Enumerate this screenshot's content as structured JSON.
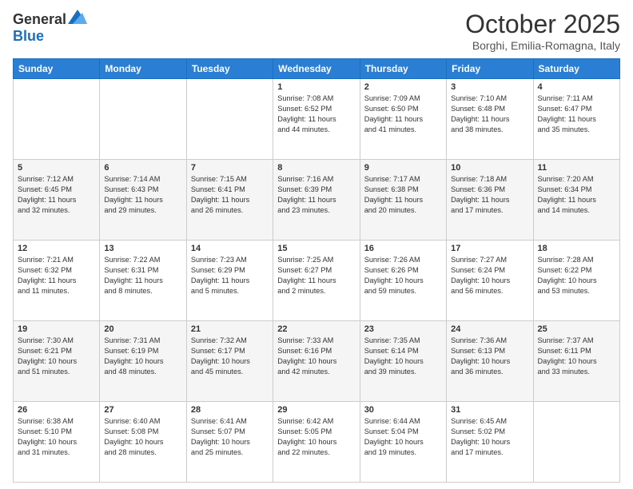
{
  "header": {
    "logo_general": "General",
    "logo_blue": "Blue",
    "month": "October 2025",
    "location": "Borghi, Emilia-Romagna, Italy"
  },
  "days_of_week": [
    "Sunday",
    "Monday",
    "Tuesday",
    "Wednesday",
    "Thursday",
    "Friday",
    "Saturday"
  ],
  "weeks": [
    [
      {
        "num": "",
        "content": ""
      },
      {
        "num": "",
        "content": ""
      },
      {
        "num": "",
        "content": ""
      },
      {
        "num": "1",
        "content": "Sunrise: 7:08 AM\nSunset: 6:52 PM\nDaylight: 11 hours\nand 44 minutes."
      },
      {
        "num": "2",
        "content": "Sunrise: 7:09 AM\nSunset: 6:50 PM\nDaylight: 11 hours\nand 41 minutes."
      },
      {
        "num": "3",
        "content": "Sunrise: 7:10 AM\nSunset: 6:48 PM\nDaylight: 11 hours\nand 38 minutes."
      },
      {
        "num": "4",
        "content": "Sunrise: 7:11 AM\nSunset: 6:47 PM\nDaylight: 11 hours\nand 35 minutes."
      }
    ],
    [
      {
        "num": "5",
        "content": "Sunrise: 7:12 AM\nSunset: 6:45 PM\nDaylight: 11 hours\nand 32 minutes."
      },
      {
        "num": "6",
        "content": "Sunrise: 7:14 AM\nSunset: 6:43 PM\nDaylight: 11 hours\nand 29 minutes."
      },
      {
        "num": "7",
        "content": "Sunrise: 7:15 AM\nSunset: 6:41 PM\nDaylight: 11 hours\nand 26 minutes."
      },
      {
        "num": "8",
        "content": "Sunrise: 7:16 AM\nSunset: 6:39 PM\nDaylight: 11 hours\nand 23 minutes."
      },
      {
        "num": "9",
        "content": "Sunrise: 7:17 AM\nSunset: 6:38 PM\nDaylight: 11 hours\nand 20 minutes."
      },
      {
        "num": "10",
        "content": "Sunrise: 7:18 AM\nSunset: 6:36 PM\nDaylight: 11 hours\nand 17 minutes."
      },
      {
        "num": "11",
        "content": "Sunrise: 7:20 AM\nSunset: 6:34 PM\nDaylight: 11 hours\nand 14 minutes."
      }
    ],
    [
      {
        "num": "12",
        "content": "Sunrise: 7:21 AM\nSunset: 6:32 PM\nDaylight: 11 hours\nand 11 minutes."
      },
      {
        "num": "13",
        "content": "Sunrise: 7:22 AM\nSunset: 6:31 PM\nDaylight: 11 hours\nand 8 minutes."
      },
      {
        "num": "14",
        "content": "Sunrise: 7:23 AM\nSunset: 6:29 PM\nDaylight: 11 hours\nand 5 minutes."
      },
      {
        "num": "15",
        "content": "Sunrise: 7:25 AM\nSunset: 6:27 PM\nDaylight: 11 hours\nand 2 minutes."
      },
      {
        "num": "16",
        "content": "Sunrise: 7:26 AM\nSunset: 6:26 PM\nDaylight: 10 hours\nand 59 minutes."
      },
      {
        "num": "17",
        "content": "Sunrise: 7:27 AM\nSunset: 6:24 PM\nDaylight: 10 hours\nand 56 minutes."
      },
      {
        "num": "18",
        "content": "Sunrise: 7:28 AM\nSunset: 6:22 PM\nDaylight: 10 hours\nand 53 minutes."
      }
    ],
    [
      {
        "num": "19",
        "content": "Sunrise: 7:30 AM\nSunset: 6:21 PM\nDaylight: 10 hours\nand 51 minutes."
      },
      {
        "num": "20",
        "content": "Sunrise: 7:31 AM\nSunset: 6:19 PM\nDaylight: 10 hours\nand 48 minutes."
      },
      {
        "num": "21",
        "content": "Sunrise: 7:32 AM\nSunset: 6:17 PM\nDaylight: 10 hours\nand 45 minutes."
      },
      {
        "num": "22",
        "content": "Sunrise: 7:33 AM\nSunset: 6:16 PM\nDaylight: 10 hours\nand 42 minutes."
      },
      {
        "num": "23",
        "content": "Sunrise: 7:35 AM\nSunset: 6:14 PM\nDaylight: 10 hours\nand 39 minutes."
      },
      {
        "num": "24",
        "content": "Sunrise: 7:36 AM\nSunset: 6:13 PM\nDaylight: 10 hours\nand 36 minutes."
      },
      {
        "num": "25",
        "content": "Sunrise: 7:37 AM\nSunset: 6:11 PM\nDaylight: 10 hours\nand 33 minutes."
      }
    ],
    [
      {
        "num": "26",
        "content": "Sunrise: 6:38 AM\nSunset: 5:10 PM\nDaylight: 10 hours\nand 31 minutes."
      },
      {
        "num": "27",
        "content": "Sunrise: 6:40 AM\nSunset: 5:08 PM\nDaylight: 10 hours\nand 28 minutes."
      },
      {
        "num": "28",
        "content": "Sunrise: 6:41 AM\nSunset: 5:07 PM\nDaylight: 10 hours\nand 25 minutes."
      },
      {
        "num": "29",
        "content": "Sunrise: 6:42 AM\nSunset: 5:05 PM\nDaylight: 10 hours\nand 22 minutes."
      },
      {
        "num": "30",
        "content": "Sunrise: 6:44 AM\nSunset: 5:04 PM\nDaylight: 10 hours\nand 19 minutes."
      },
      {
        "num": "31",
        "content": "Sunrise: 6:45 AM\nSunset: 5:02 PM\nDaylight: 10 hours\nand 17 minutes."
      },
      {
        "num": "",
        "content": ""
      }
    ]
  ]
}
